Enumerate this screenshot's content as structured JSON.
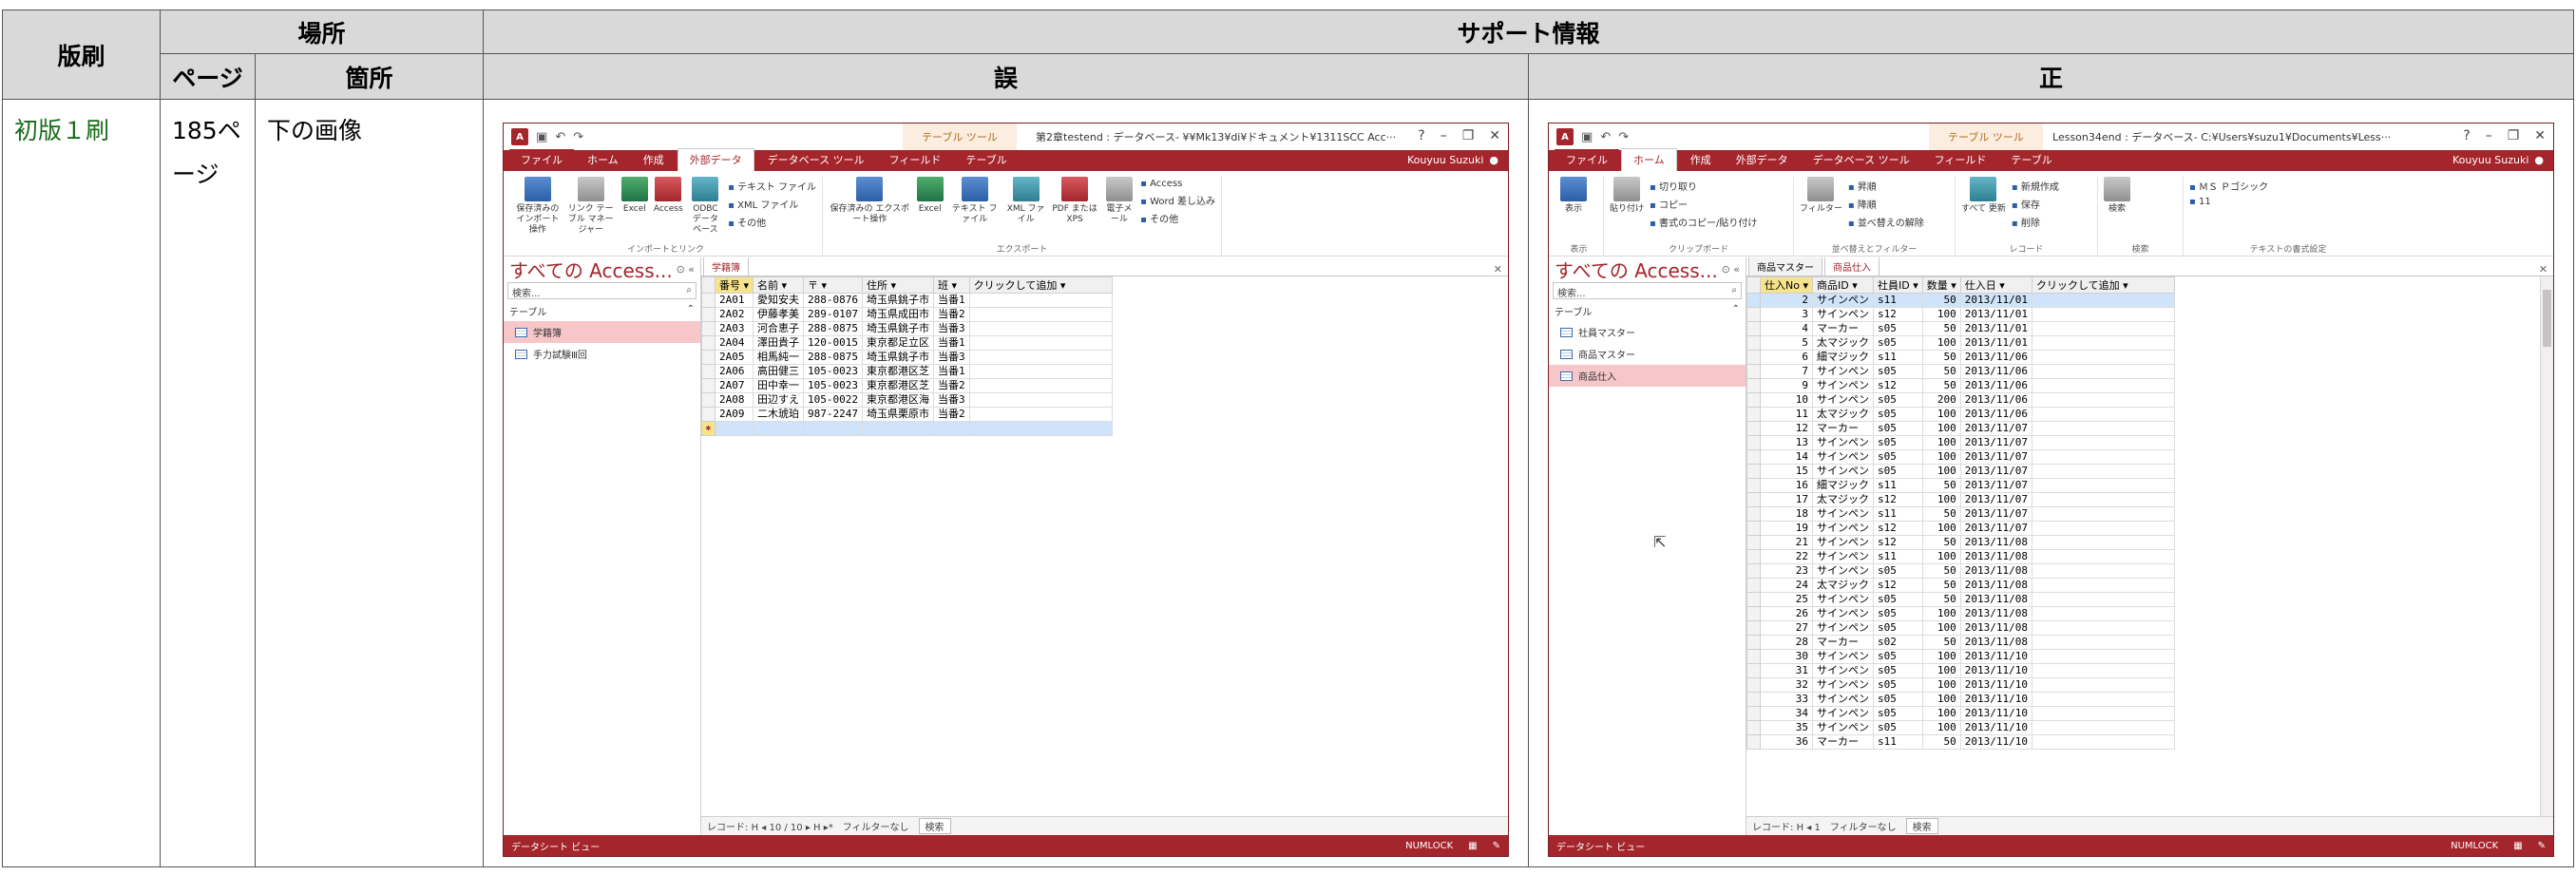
{
  "header": {
    "edition": "版刷",
    "location": "場所",
    "page": "ページ",
    "spot": "箇所",
    "support": "サポート情報",
    "wrong": "誤",
    "right": "正"
  },
  "row": {
    "edition": "初版１刷",
    "page": "185ページ",
    "spot": "下の画像"
  },
  "wrong_shot": {
    "title": "第2章testend : データベース- ¥¥Mk13¥di¥ドキュメント¥1311SCC Acc···",
    "context_tab": "テーブル ツール",
    "tabs": [
      "ファイル",
      "ホーム",
      "作成",
      "外部データ",
      "データベース ツール",
      "フィールド",
      "テーブル"
    ],
    "active_tab": "外部データ",
    "user": "Kouyuu Suzuki",
    "ribbon": {
      "import_group": "インポートとリンク",
      "export_group": "エクスポート",
      "import_buttons": [
        "保存済みの インポート操作",
        "リンク テーブル マネージャー",
        "Excel",
        "Access",
        "ODBC データベース"
      ],
      "import_small": [
        "テキスト ファイル",
        "XML ファイル",
        "その他"
      ],
      "export_buttons": [
        "保存済みの エクスポート操作",
        "Excel",
        "テキスト ファイル",
        "XML ファイル",
        "PDF または XPS",
        "電子メール"
      ],
      "export_small": [
        "Access",
        "Word 差し込み",
        "その他"
      ]
    },
    "nav": {
      "title": "すべての Access...",
      "search": "検索...",
      "group": "テーブル",
      "items": [
        "学籍簿",
        "手力試験Ⅲ回"
      ]
    },
    "doc_tab": "学籍簿",
    "columns": [
      "番号",
      "名前",
      "〒",
      "住所",
      "班",
      "クリックして追加"
    ],
    "rows": [
      [
        "2A01",
        "愛知安夫",
        "288-0876",
        "埼玉県銚子市",
        "当番1"
      ],
      [
        "2A02",
        "伊藤孝美",
        "289-0107",
        "埼玉県成田市",
        "当番2"
      ],
      [
        "2A03",
        "河合恵子",
        "288-0875",
        "埼玉県銚子市",
        "当番3"
      ],
      [
        "2A04",
        "澤田貴子",
        "120-0015",
        "東京都足立区",
        "当番1"
      ],
      [
        "2A05",
        "相馬純一",
        "288-0875",
        "埼玉県銚子市",
        "当番3"
      ],
      [
        "2A06",
        "高田健三",
        "105-0023",
        "東京都港区芝",
        "当番1"
      ],
      [
        "2A07",
        "田中幸一",
        "105-0023",
        "東京都港区芝",
        "当番2"
      ],
      [
        "2A08",
        "田辺すえ",
        "105-0022",
        "東京都港区海",
        "当番3"
      ],
      [
        "2A09",
        "二木琥珀",
        "987-2247",
        "埼玉県栗原市",
        "当番2"
      ]
    ],
    "record_nav": "レコード: H ◂ 10 / 10 ▸ H ▸*",
    "filter": "フィルターなし",
    "search": "検索",
    "status": "データシート ビュー",
    "numlock": "NUMLOCK"
  },
  "right_shot": {
    "title": "Lesson34end : データベース- C:¥Users¥suzu1¥Documents¥Less···",
    "context_tab": "テーブル ツール",
    "tabs": [
      "ファイル",
      "ホーム",
      "作成",
      "外部データ",
      "データベース ツール",
      "フィールド",
      "テーブル"
    ],
    "active_tab": "ホーム",
    "user": "Kouyuu Suzuki",
    "ribbon": {
      "view_group": "表示",
      "clipboard_group": "クリップボード",
      "sort_group": "並べ替えとフィルター",
      "record_group": "レコード",
      "find_group": "検索",
      "text_group": "テキストの書式設定",
      "view_btn": "表示",
      "paste_btn": "貼り付け",
      "clip_small": [
        "切り取り",
        "コピー",
        "書式のコピー/貼り付け"
      ],
      "filter_btn": "フィルター",
      "sort_small": [
        "昇順",
        "降順",
        "並べ替えの解除"
      ],
      "refresh_btn": "すべて 更新",
      "record_small": [
        "新規作成",
        "保存",
        "削除"
      ],
      "find_btn": "検索",
      "font": "ＭＳ Ｐゴシック",
      "font_size": "11"
    },
    "nav": {
      "title": "すべての Access...",
      "search": "検索...",
      "group": "テーブル",
      "items": [
        "社員マスター",
        "商品マスター",
        "商品仕入"
      ]
    },
    "doc_tabs": [
      "商品マスター",
      "商品仕入"
    ],
    "columns": [
      "仕入No",
      "商品ID",
      "社員ID",
      "数量",
      "仕入日",
      "クリックして追加"
    ],
    "rows": [
      [
        "2",
        "サインペン",
        "s11",
        "50",
        "2013/11/01"
      ],
      [
        "3",
        "サインペン",
        "s12",
        "100",
        "2013/11/01"
      ],
      [
        "4",
        "マーカー",
        "s05",
        "50",
        "2013/11/01"
      ],
      [
        "5",
        "太マジック",
        "s05",
        "100",
        "2013/11/01"
      ],
      [
        "6",
        "細マジック",
        "s11",
        "50",
        "2013/11/06"
      ],
      [
        "7",
        "サインペン",
        "s05",
        "50",
        "2013/11/06"
      ],
      [
        "9",
        "サインペン",
        "s12",
        "50",
        "2013/11/06"
      ],
      [
        "10",
        "サインペン",
        "s05",
        "200",
        "2013/11/06"
      ],
      [
        "11",
        "太マジック",
        "s05",
        "100",
        "2013/11/06"
      ],
      [
        "12",
        "マーカー",
        "s05",
        "100",
        "2013/11/07"
      ],
      [
        "13",
        "サインペン",
        "s05",
        "100",
        "2013/11/07"
      ],
      [
        "14",
        "サインペン",
        "s05",
        "100",
        "2013/11/07"
      ],
      [
        "15",
        "サインペン",
        "s05",
        "100",
        "2013/11/07"
      ],
      [
        "16",
        "細マジック",
        "s11",
        "50",
        "2013/11/07"
      ],
      [
        "17",
        "太マジック",
        "s12",
        "100",
        "2013/11/07"
      ],
      [
        "18",
        "サインペン",
        "s11",
        "50",
        "2013/11/07"
      ],
      [
        "19",
        "サインペン",
        "s12",
        "100",
        "2013/11/07"
      ],
      [
        "21",
        "サインペン",
        "s12",
        "50",
        "2013/11/08"
      ],
      [
        "22",
        "サインペン",
        "s11",
        "100",
        "2013/11/08"
      ],
      [
        "23",
        "サインペン",
        "s05",
        "50",
        "2013/11/08"
      ],
      [
        "24",
        "太マジック",
        "s12",
        "50",
        "2013/11/08"
      ],
      [
        "25",
        "サインペン",
        "s05",
        "50",
        "2013/11/08"
      ],
      [
        "26",
        "サインペン",
        "s05",
        "100",
        "2013/11/08"
      ],
      [
        "27",
        "サインペン",
        "s05",
        "100",
        "2013/11/08"
      ],
      [
        "28",
        "マーカー",
        "s02",
        "50",
        "2013/11/08"
      ],
      [
        "30",
        "サインペン",
        "s05",
        "100",
        "2013/11/10"
      ],
      [
        "31",
        "サインペン",
        "s05",
        "100",
        "2013/11/10"
      ],
      [
        "32",
        "サインペン",
        "s05",
        "100",
        "2013/11/10"
      ],
      [
        "33",
        "サインペン",
        "s05",
        "100",
        "2013/11/10"
      ],
      [
        "34",
        "サインペン",
        "s05",
        "100",
        "2013/11/10"
      ],
      [
        "35",
        "サインペン",
        "s05",
        "100",
        "2013/11/10"
      ],
      [
        "36",
        "マーカー",
        "s11",
        "50",
        "2013/11/10"
      ]
    ],
    "record_nav": "レコード: H ◂ 1",
    "filter": "フィルターなし",
    "search": "検索",
    "status": "データシート ビュー",
    "numlock": "NUMLOCK"
  },
  "colors": {
    "access_red": "#a4262c",
    "edition_green": "#1a6b1a",
    "header_gray": "#d9d9d9"
  }
}
